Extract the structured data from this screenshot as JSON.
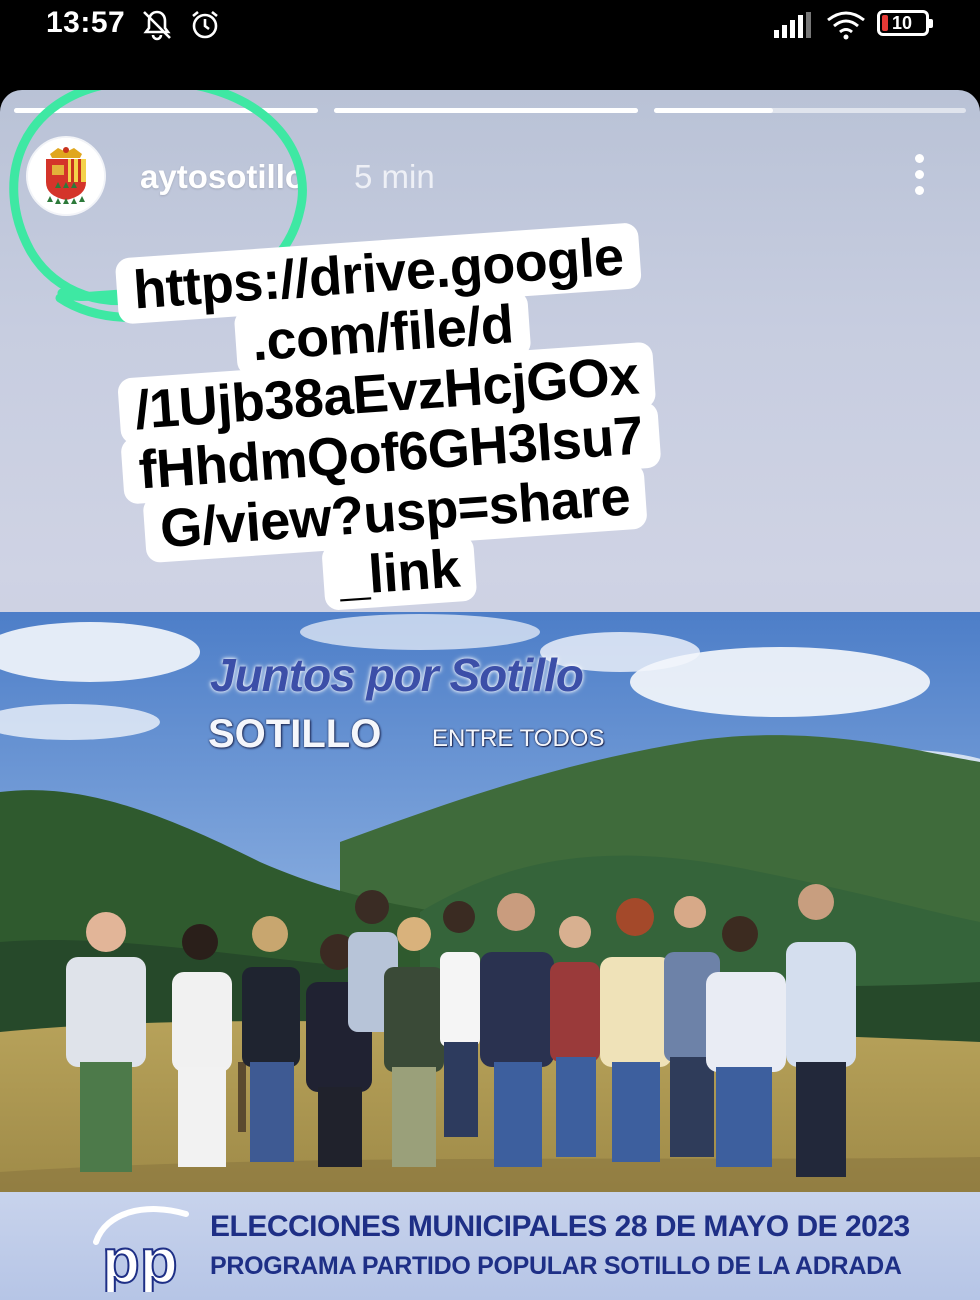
{
  "status_bar": {
    "time": "13:57",
    "battery_level": "10",
    "icons": [
      "mute-icon",
      "alarm-icon",
      "signal-icon",
      "wifi-icon",
      "battery-icon"
    ]
  },
  "story": {
    "progress_segments": [
      1,
      1,
      0.38
    ],
    "username": "aytosotillo",
    "time_ago": "5 min",
    "menu_icon": "more-vertical-icon",
    "annotation_color": "#3ee8a3"
  },
  "link_sticker": {
    "lines": [
      "https://drive.google",
      ".com/file/d",
      "/1Ujb38aEvzHcjGOx",
      "fHhdmQof6GH3Isu7",
      "G/view?usp=share",
      "_link"
    ]
  },
  "poster": {
    "headline": "Juntos por Sotillo",
    "slogan_main": "SOTILLO",
    "slogan_sub": "ENTRE TODOS",
    "logo_text": "pp",
    "footer_line1": "ELECCIONES MUNICIPALES 28 DE MAYO DE 2023",
    "footer_line2": "PROGRAMA PARTIDO POPULAR SOTILLO DE LA ADRADA",
    "brand_color": "#1e2f86"
  }
}
